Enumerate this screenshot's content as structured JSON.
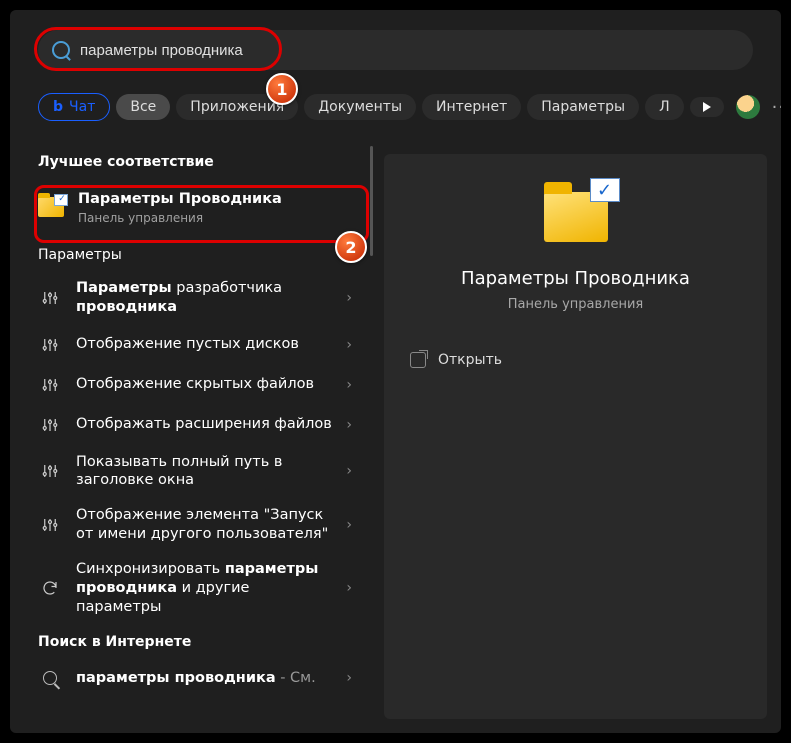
{
  "search": {
    "value": "параметры проводника"
  },
  "tabs": {
    "chat": "Чат",
    "all": "Все",
    "apps": "Приложения",
    "docs": "Документы",
    "web": "Интернет",
    "settings": "Параметры",
    "more_letter": "Л"
  },
  "annotations": {
    "one": "1",
    "two": "2"
  },
  "sections": {
    "best": "Лучшее соответствие",
    "params": "Параметры",
    "websearch": "Поиск в Интернете"
  },
  "best_match": {
    "title": "Параметры Проводника",
    "sub": "Панель управления"
  },
  "params_items": [
    {
      "pre": "Параметры",
      "bold": " разработчика ",
      "post": "проводника"
    },
    {
      "plain": "Отображение пустых дисков"
    },
    {
      "plain": "Отображение скрытых файлов"
    },
    {
      "plain": "Отображать расширения файлов"
    },
    {
      "plain": "Показывать полный путь в заголовке окна"
    },
    {
      "plain": "Отображение элемента \"Запуск от имени другого пользователя\""
    },
    {
      "pre": "Синхронизировать ",
      "bold": "параметры проводника",
      "post": " и другие параметры"
    }
  ],
  "web_item": {
    "term": "параметры проводника",
    "suffix": " - См."
  },
  "detail": {
    "title": "Параметры Проводника",
    "sub": "Панель управления",
    "open": "Открыть"
  }
}
